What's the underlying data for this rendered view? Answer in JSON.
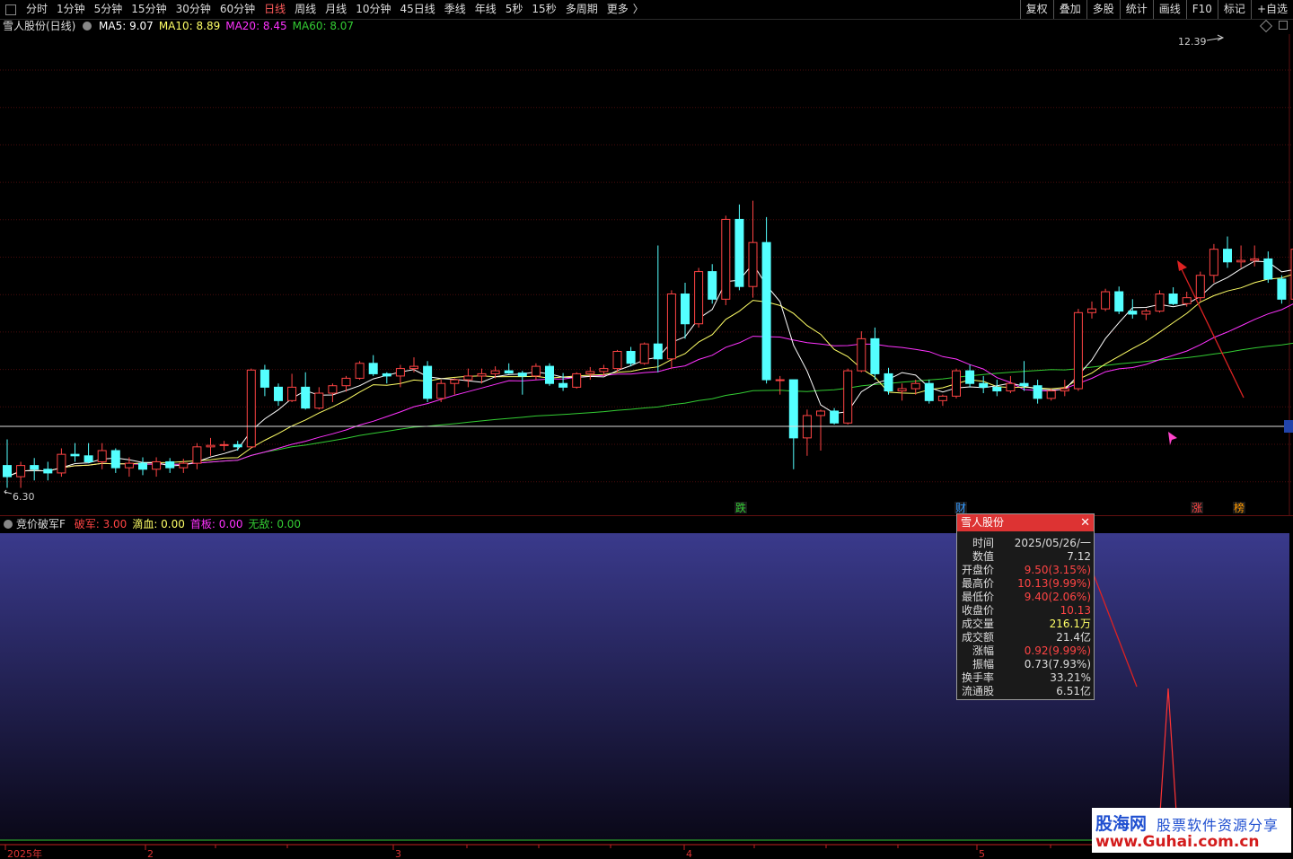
{
  "toolbar": {
    "periods": [
      "分时",
      "1分钟",
      "5分钟",
      "15分钟",
      "30分钟",
      "60分钟",
      "日线",
      "周线",
      "月线",
      "10分钟",
      "45日线",
      "季线",
      "年线",
      "5秒",
      "15秒",
      "多周期",
      "更多"
    ],
    "active_period": "日线",
    "more_arrow": "〉",
    "right_tools": [
      "复权",
      "叠加",
      "多股",
      "统计",
      "画线",
      "F10",
      "标记",
      "+自选"
    ]
  },
  "main_chart": {
    "title": "雪人股份(日线)",
    "ma_labels": [
      {
        "text": "MA5: 9.07",
        "color": "#ffffff"
      },
      {
        "text": "MA10: 8.89",
        "color": "#ffff66"
      },
      {
        "text": "MA20: 8.45",
        "color": "#ff33ff"
      },
      {
        "text": "MA60: 8.07",
        "color": "#33cc33"
      }
    ],
    "high_label": "12.39",
    "low_label": "6.30",
    "event_markers": [
      {
        "text": "跌",
        "color": "#33cc33"
      },
      {
        "text": "财",
        "color": "#3399ff"
      },
      {
        "text": "涨",
        "color": "#ff4444"
      },
      {
        "text": "榜",
        "color": "#ff9900"
      }
    ],
    "colors": {
      "up": "#ff4444",
      "down": "#54ffff",
      "ma5": "#ffffff",
      "ma10": "#ffff66",
      "ma20": "#ff33ff",
      "ma60": "#33cc33"
    }
  },
  "indicator": {
    "name": "竞价破军F",
    "values": [
      {
        "text": "破军: 3.00",
        "color": "#ff4444"
      },
      {
        "text": "滴血: 0.00",
        "color": "#ffff66"
      },
      {
        "text": "首板: 0.00",
        "color": "#ff33ff"
      },
      {
        "text": "无敌: 0.00",
        "color": "#33cc33"
      }
    ]
  },
  "x_axis": {
    "labels": [
      "2025年",
      "2",
      "3",
      "4",
      "5"
    ]
  },
  "popup": {
    "title": "雪人股份",
    "close": "✕",
    "rows": [
      {
        "label": "时间",
        "value": "2025/05/26/一",
        "color": "#dddddd"
      },
      {
        "label": "数值",
        "value": "7.12",
        "color": "#dddddd"
      },
      {
        "label": "开盘价",
        "value": "9.50(3.15%)",
        "color": "#ff4444"
      },
      {
        "label": "最高价",
        "value": "10.13(9.99%)",
        "color": "#ff4444"
      },
      {
        "label": "最低价",
        "value": "9.40(2.06%)",
        "color": "#ff4444"
      },
      {
        "label": "收盘价",
        "value": "10.13",
        "color": "#ff4444"
      },
      {
        "label": "成交量",
        "value": "216.1万",
        "color": "#ffff66"
      },
      {
        "label": "成交额",
        "value": "21.4亿",
        "color": "#dddddd"
      },
      {
        "label": "涨幅",
        "value": "0.92(9.99%)",
        "color": "#ff4444"
      },
      {
        "label": "振幅",
        "value": "0.73(7.93%)",
        "color": "#dddddd"
      },
      {
        "label": "换手率",
        "value": "33.21%",
        "color": "#dddddd"
      },
      {
        "label": "流通股",
        "value": "6.51亿",
        "color": "#dddddd"
      }
    ]
  },
  "watermark": {
    "logo": "股海网",
    "slogan": "股票软件资源分享",
    "url": "www.Guhai.com.cn"
  },
  "chart_data": {
    "type": "candlestick",
    "title": "雪人股份(日线)",
    "y_marks": {
      "high": 12.39,
      "low": 6.3
    },
    "candles": [
      [
        6.75,
        7.1,
        6.45,
        6.6
      ],
      [
        6.6,
        6.8,
        6.45,
        6.75
      ],
      [
        6.75,
        6.85,
        6.55,
        6.7
      ],
      [
        6.7,
        6.8,
        6.55,
        6.65
      ],
      [
        6.65,
        6.98,
        6.6,
        6.9
      ],
      [
        6.9,
        7.05,
        6.8,
        6.88
      ],
      [
        6.88,
        7.05,
        6.78,
        6.8
      ],
      [
        6.8,
        7.05,
        6.7,
        6.95
      ],
      [
        6.95,
        6.98,
        6.65,
        6.72
      ],
      [
        6.72,
        6.86,
        6.6,
        6.78
      ],
      [
        6.78,
        6.86,
        6.62,
        6.7
      ],
      [
        6.7,
        6.86,
        6.6,
        6.8
      ],
      [
        6.8,
        6.85,
        6.65,
        6.72
      ],
      [
        6.72,
        6.84,
        6.65,
        6.78
      ],
      [
        6.78,
        7.05,
        6.7,
        7.0
      ],
      [
        7.0,
        7.12,
        6.88,
        7.02
      ],
      [
        7.02,
        7.08,
        6.95,
        7.03
      ],
      [
        7.03,
        7.08,
        6.95,
        7.0
      ],
      [
        7.0,
        8.05,
        6.98,
        8.03
      ],
      [
        8.03,
        8.1,
        7.68,
        7.8
      ],
      [
        7.8,
        7.85,
        7.55,
        7.62
      ],
      [
        7.62,
        7.98,
        7.6,
        7.8
      ],
      [
        7.8,
        8.0,
        7.5,
        7.52
      ],
      [
        7.52,
        7.8,
        7.5,
        7.72
      ],
      [
        7.72,
        7.85,
        7.6,
        7.82
      ],
      [
        7.82,
        7.95,
        7.74,
        7.92
      ],
      [
        7.92,
        8.15,
        7.9,
        8.12
      ],
      [
        8.12,
        8.23,
        7.95,
        7.98
      ],
      [
        7.98,
        8.0,
        7.85,
        7.95
      ],
      [
        7.95,
        8.1,
        7.8,
        8.05
      ],
      [
        8.05,
        8.2,
        8.0,
        8.08
      ],
      [
        8.08,
        8.15,
        7.6,
        7.65
      ],
      [
        7.65,
        7.9,
        7.6,
        7.85
      ],
      [
        7.85,
        7.92,
        7.7,
        7.9
      ],
      [
        7.9,
        8.05,
        7.8,
        7.95
      ],
      [
        7.95,
        8.05,
        7.85,
        7.98
      ],
      [
        7.98,
        8.08,
        7.92,
        8.02
      ],
      [
        8.02,
        8.12,
        7.98,
        7.99
      ],
      [
        7.99,
        8.02,
        7.7,
        7.95
      ],
      [
        7.95,
        8.12,
        7.9,
        8.08
      ],
      [
        8.08,
        8.12,
        7.82,
        7.85
      ],
      [
        7.85,
        7.99,
        7.75,
        7.8
      ],
      [
        7.8,
        8.0,
        7.78,
        7.98
      ],
      [
        7.98,
        8.07,
        7.9,
        8.01
      ],
      [
        8.01,
        8.1,
        7.95,
        8.05
      ],
      [
        8.05,
        8.3,
        8.0,
        8.28
      ],
      [
        8.28,
        8.34,
        8.08,
        8.12
      ],
      [
        8.12,
        8.4,
        8.1,
        8.38
      ],
      [
        8.38,
        9.7,
        8.0,
        8.18
      ],
      [
        8.18,
        9.1,
        8.05,
        9.05
      ],
      [
        9.05,
        9.2,
        8.45,
        8.65
      ],
      [
        8.65,
        9.4,
        8.6,
        9.35
      ],
      [
        9.35,
        9.45,
        8.92,
        8.98
      ],
      [
        8.98,
        10.1,
        8.9,
        10.05
      ],
      [
        10.05,
        10.25,
        9.1,
        9.15
      ],
      [
        9.15,
        10.3,
        9.0,
        9.74
      ],
      [
        9.74,
        10.08,
        7.85,
        7.9
      ],
      [
        7.9,
        7.95,
        7.7,
        7.9
      ],
      [
        7.9,
        7.9,
        6.7,
        7.12
      ],
      [
        7.12,
        7.5,
        6.88,
        7.42
      ],
      [
        7.42,
        7.5,
        6.95,
        7.48
      ],
      [
        7.48,
        7.52,
        7.3,
        7.32
      ],
      [
        7.32,
        8.05,
        7.3,
        8.02
      ],
      [
        8.02,
        8.55,
        8.0,
        8.45
      ],
      [
        8.45,
        8.6,
        7.9,
        7.98
      ],
      [
        7.98,
        8.06,
        7.7,
        7.75
      ],
      [
        7.75,
        7.85,
        7.62,
        7.78
      ],
      [
        7.78,
        7.9,
        7.7,
        7.85
      ],
      [
        7.85,
        7.9,
        7.58,
        7.62
      ],
      [
        7.62,
        7.7,
        7.55,
        7.68
      ],
      [
        7.68,
        8.05,
        7.65,
        8.02
      ],
      [
        8.02,
        8.1,
        7.8,
        7.85
      ],
      [
        7.85,
        7.95,
        7.72,
        7.8
      ],
      [
        7.8,
        7.9,
        7.68,
        7.75
      ],
      [
        7.75,
        7.95,
        7.72,
        7.85
      ],
      [
        7.85,
        8.15,
        7.75,
        7.82
      ],
      [
        7.82,
        7.9,
        7.58,
        7.65
      ],
      [
        7.65,
        7.78,
        7.62,
        7.75
      ],
      [
        7.75,
        7.9,
        7.68,
        7.78
      ],
      [
        7.78,
        8.85,
        7.75,
        8.8
      ],
      [
        8.8,
        8.95,
        8.72,
        8.85
      ],
      [
        8.85,
        9.12,
        8.82,
        9.08
      ],
      [
        9.08,
        9.15,
        8.78,
        8.82
      ],
      [
        8.82,
        8.98,
        8.72,
        8.78
      ],
      [
        8.78,
        8.85,
        8.7,
        8.82
      ],
      [
        8.82,
        9.1,
        8.8,
        9.05
      ],
      [
        9.05,
        9.14,
        8.9,
        8.92
      ],
      [
        8.92,
        9.08,
        8.88,
        9.0
      ],
      [
        9.0,
        9.35,
        8.95,
        9.3
      ],
      [
        9.3,
        9.72,
        9.2,
        9.65
      ],
      [
        9.65,
        9.82,
        9.4,
        9.48
      ],
      [
        9.48,
        9.7,
        9.4,
        9.5
      ],
      [
        9.5,
        9.7,
        9.42,
        9.52
      ],
      [
        9.52,
        9.62,
        9.2,
        9.25
      ],
      [
        9.25,
        9.3,
        8.92,
        8.98
      ],
      [
        8.98,
        9.7,
        8.88,
        9.65
      ],
      [
        9.65,
        9.8,
        8.9,
        9.0
      ],
      [
        9.5,
        10.13,
        9.4,
        10.13
      ],
      [
        10.13,
        11.7,
        10.0,
        10.35
      ],
      [
        10.35,
        11.45,
        10.3,
        10.5
      ],
      [
        10.5,
        11.82,
        10.48,
        11.8
      ],
      [
        11.8,
        12.05,
        11.4,
        11.52
      ],
      [
        11.52,
        12.2,
        10.9,
        11.55
      ],
      [
        11.55,
        12.39,
        11.4,
        12.23
      ],
      [
        12.23,
        12.1,
        11.2,
        11.95
      ]
    ]
  }
}
